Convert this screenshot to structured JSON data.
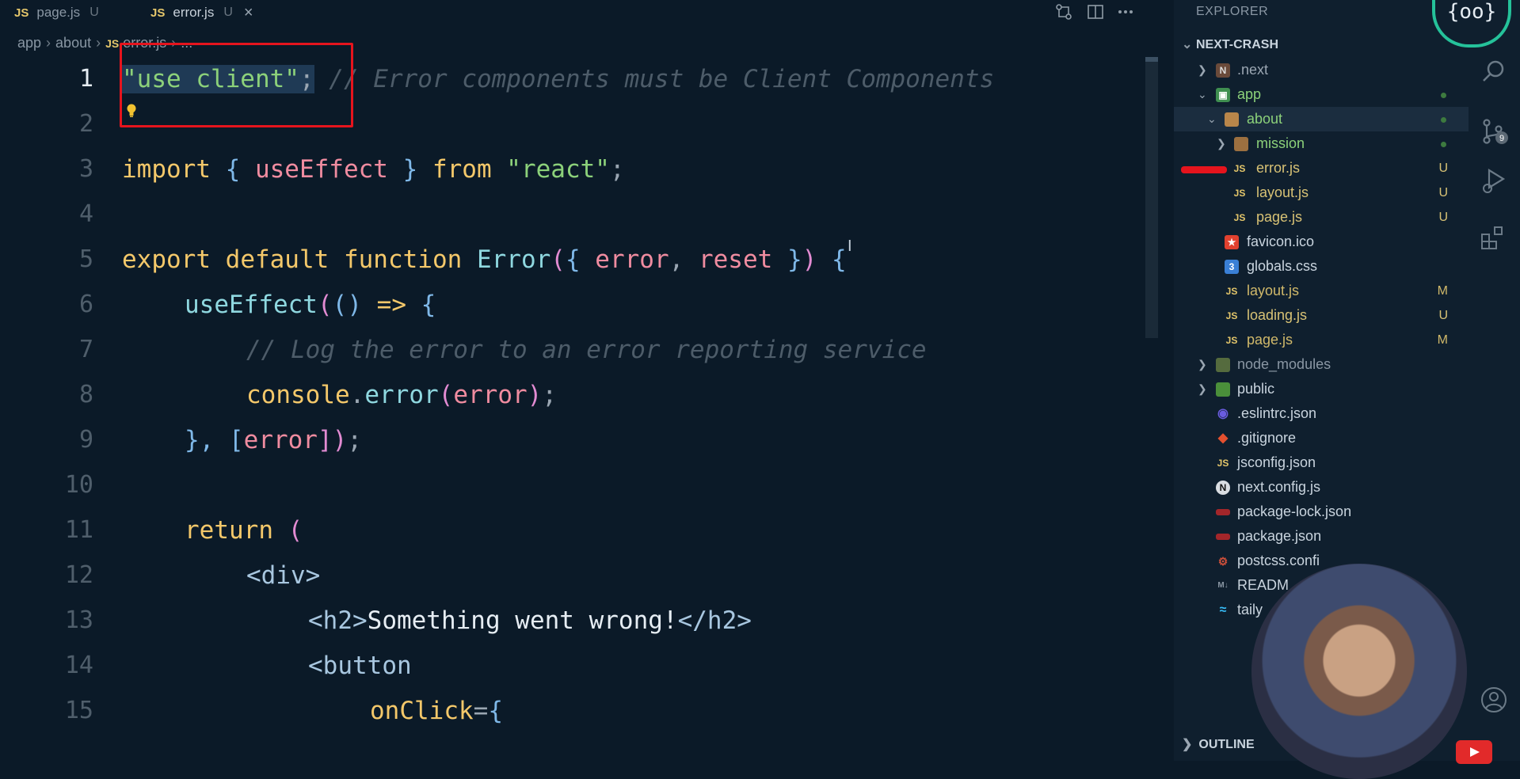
{
  "tabs": [
    {
      "icon": "JS",
      "label": "page.js",
      "status": "U",
      "active": false
    },
    {
      "icon": "JS",
      "label": "error.js",
      "status": "U",
      "active": true,
      "close": "×"
    }
  ],
  "tab_actions": [
    "compare-icon",
    "split-editor-icon",
    "more-icon"
  ],
  "breadcrumb": {
    "p1": "app",
    "p2": "about",
    "icon": "JS",
    "p3": "error.js",
    "p4": "..."
  },
  "code": {
    "l1": {
      "n": "1",
      "a": "\"use client\"",
      "b": ";",
      "c": " // Error components must be Client Components"
    },
    "l2": {
      "n": "2"
    },
    "l3": {
      "n": "3",
      "a": "import",
      "b": " { ",
      "c": "useEffect",
      "d": " } ",
      "e": "from",
      "f": " \"react\"",
      "g": ";"
    },
    "l4": {
      "n": "4"
    },
    "l5": {
      "n": "5",
      "a": "export",
      "b": " ",
      "c": "default",
      "d": " ",
      "e": "function",
      "f": " ",
      "g": "Error",
      "h": "(",
      "i": "{ ",
      "j": "error",
      "k": ", ",
      "l": "reset",
      "m": " }",
      "o": ") ",
      "p": "{"
    },
    "l6": {
      "n": "6",
      "a": "useEffect",
      "b": "(",
      "c": "() ",
      "d": "=>",
      "e": " {"
    },
    "l7": {
      "n": "7",
      "a": "// Log the error to an error reporting service"
    },
    "l8": {
      "n": "8",
      "a": "console",
      "b": ".",
      "c": "error",
      "d": "(",
      "e": "error",
      "f": ")",
      "g": ";"
    },
    "l9": {
      "n": "9",
      "a": "}, [",
      "b": "error",
      "c": "])",
      "d": ";"
    },
    "l10": {
      "n": "10"
    },
    "l11": {
      "n": "11",
      "a": "return",
      "b": " ("
    },
    "l12": {
      "n": "12",
      "a": "<div>"
    },
    "l13": {
      "n": "13",
      "a": "<h2>",
      "b": "Something went wrong!",
      "c": "</h2>"
    },
    "l14": {
      "n": "14",
      "a": "<button"
    },
    "l15": {
      "n": "15",
      "a": "onClick",
      "b": "=",
      "c": "{"
    }
  },
  "explorer": {
    "title": "EXPLORER",
    "project": "NEXT-CRASH",
    "items": [
      {
        "label": ".next",
        "status": ""
      },
      {
        "label": "app",
        "status": "dot"
      },
      {
        "label": "about",
        "status": "dot"
      },
      {
        "label": "mission",
        "status": "dot"
      },
      {
        "label": "error.js",
        "status": "U"
      },
      {
        "label": "layout.js",
        "status": "U"
      },
      {
        "label": "page.js",
        "status": "U"
      },
      {
        "label": "favicon.ico",
        "status": ""
      },
      {
        "label": "globals.css",
        "status": ""
      },
      {
        "label": "layout.js",
        "status": "M"
      },
      {
        "label": "loading.js",
        "status": "U"
      },
      {
        "label": "page.js",
        "status": "M"
      },
      {
        "label": "node_modules",
        "status": ""
      },
      {
        "label": "public",
        "status": ""
      },
      {
        "label": ".eslintrc.json",
        "status": ""
      },
      {
        "label": ".gitignore",
        "status": ""
      },
      {
        "label": "jsconfig.json",
        "status": ""
      },
      {
        "label": "next.config.js",
        "status": ""
      },
      {
        "label": "package-lock.json",
        "status": ""
      },
      {
        "label": "package.json",
        "status": ""
      },
      {
        "label": "postcss.confi",
        "status": ""
      },
      {
        "label": "READM",
        "status": ""
      },
      {
        "label": "taily",
        "status": ""
      }
    ],
    "outline": "OUTLINE"
  },
  "logo_text": "{oo}",
  "colors": {
    "accent": "#25c29a",
    "highlight_box": "#e6141d",
    "bg": "#0b1a28"
  }
}
